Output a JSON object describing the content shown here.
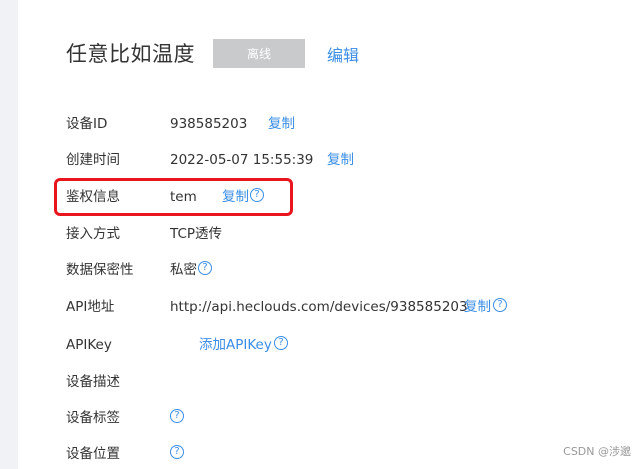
{
  "header": {
    "title": "任意比如温度",
    "status": "离线",
    "edit_label": "编辑"
  },
  "fields": {
    "device_id": {
      "label": "设备ID",
      "value": "938585203",
      "action": "复制"
    },
    "created": {
      "label": "创建时间",
      "value": "2022-05-07 15:55:39",
      "action": "复制"
    },
    "auth": {
      "label": "鉴权信息",
      "value": "tem",
      "action": "复制",
      "help": "?"
    },
    "access": {
      "label": "接入方式",
      "value": "TCP透传"
    },
    "privacy": {
      "label": "数据保密性",
      "value": "私密",
      "help": "?"
    },
    "api_url": {
      "label": "API地址",
      "value": "http://api.heclouds.com/devices/938585203",
      "action": "复制",
      "help": "?"
    },
    "api_key": {
      "label": "APIKey",
      "action": "添加APIKey",
      "help": "?"
    },
    "description": {
      "label": "设备描述"
    },
    "tags": {
      "label": "设备标签",
      "help": "?"
    },
    "location": {
      "label": "设备位置",
      "help": "?"
    }
  },
  "watermark": "CSDN @涉邈",
  "colors": {
    "link": "#3a8ee6",
    "status_bg": "#c8cacc",
    "highlight": "#e8151c",
    "text": "#333333"
  }
}
